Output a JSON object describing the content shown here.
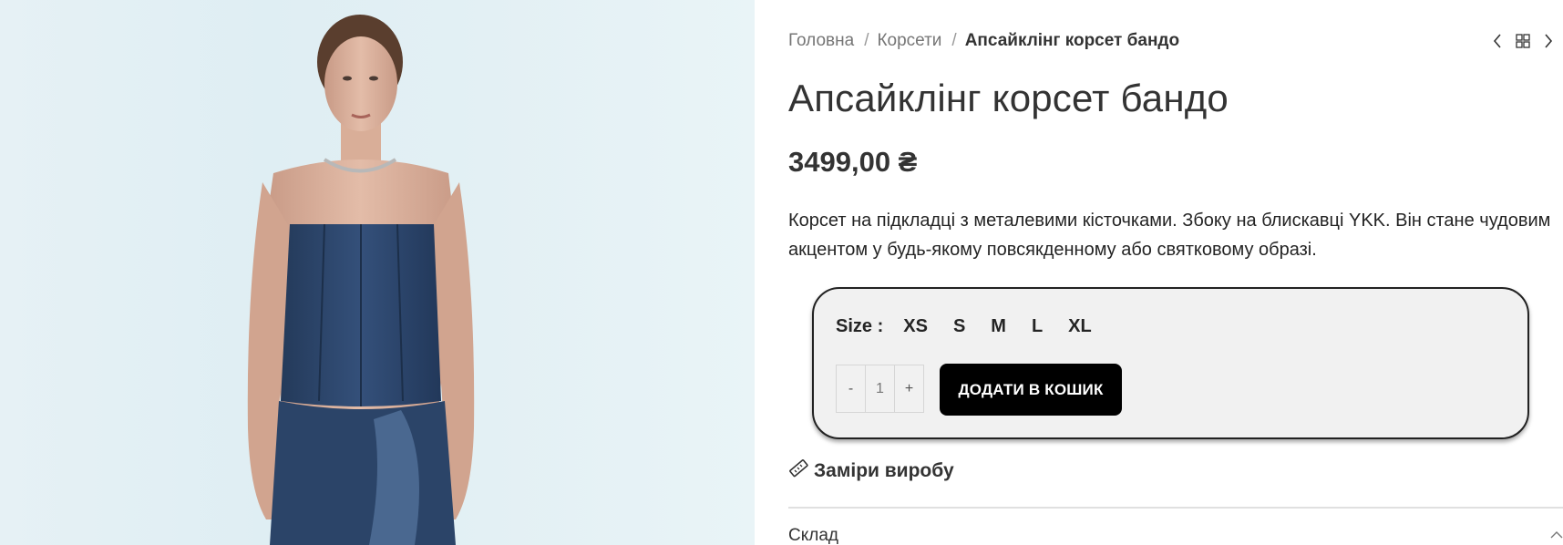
{
  "breadcrumb": {
    "items": [
      "Головна",
      "Корсети"
    ],
    "separator": "/",
    "current": "Апсайклінг корсет бандо"
  },
  "nav_icons": [
    "chevron-left-icon",
    "grid-icon",
    "chevron-right-icon"
  ],
  "product": {
    "title": "Апсайклінг корсет бандо",
    "price": "3499,00 ₴",
    "description": "Корсет на підкладці з металевими кісточками. Збоку на блискавці YKK. Він стане чудовим акцентом у будь-якому повсякденному або святковому образі."
  },
  "cart": {
    "size_label": "Size :",
    "sizes": [
      "XS",
      "S",
      "M",
      "L",
      "XL"
    ],
    "qty_minus": "-",
    "qty_value": "1",
    "qty_plus": "+",
    "add_to_cart": "ДОДАТИ В КОШИК"
  },
  "measurements": {
    "icon": "ruler-icon",
    "label": "Заміри виробу"
  },
  "accordion": {
    "label": "Склад",
    "icon": "chevron-up-icon"
  },
  "colors": {
    "button_bg": "#000000",
    "box_bg": "#f1f1f1",
    "denim": "#2c4262"
  }
}
